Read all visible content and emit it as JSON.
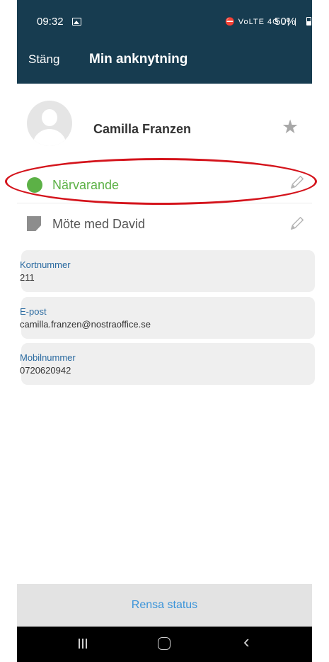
{
  "status_bar": {
    "time": "09:32",
    "icons_text": "⛔ VoLTE 4G .❘❘",
    "battery": "50%"
  },
  "header": {
    "close_label": "Stäng",
    "title": "Min anknytning"
  },
  "contact": {
    "name": "Camilla Franzen"
  },
  "presence": {
    "label": "Närvarande",
    "color": "#5cb146"
  },
  "note": {
    "label": "Möte med David"
  },
  "info": [
    {
      "label": "Kortnummer",
      "value": "211"
    },
    {
      "label": "E-post",
      "value": "camilla.franzen@nostraoffice.se"
    },
    {
      "label": "Mobilnummer",
      "value": "0720620942"
    }
  ],
  "bottom": {
    "clear_status_label": "Rensa status"
  },
  "colors": {
    "header_bg": "#173c50",
    "accent_link": "#3b94d9",
    "label_blue": "#2a6aa0",
    "highlight": "#d4141c"
  },
  "icons": [
    "gallery-icon",
    "battery-icon",
    "avatar-icon",
    "star-icon",
    "pencil-icon",
    "note-icon",
    "recent-apps-icon",
    "home-icon",
    "back-icon"
  ]
}
